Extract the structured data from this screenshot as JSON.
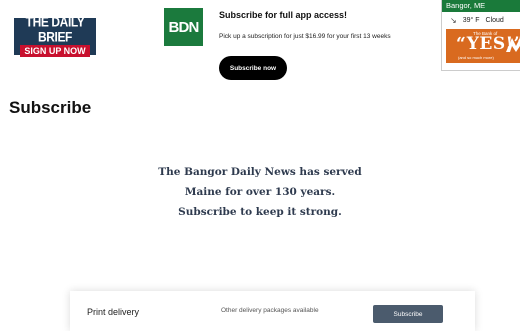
{
  "daily_brief": {
    "title": "THE DAILY BRIEF",
    "cta": "SIGN UP NOW"
  },
  "logo": {
    "text": "BDN"
  },
  "promo": {
    "title": "Subscribe for full app access!",
    "description": "Pick up a subscription for just $16.99 for your first 13 weeks",
    "button": "Subscribe now"
  },
  "weather": {
    "location": "Bangor, ME",
    "icon": "wind-icon",
    "temperature": "39° F",
    "condition": "Cloud",
    "ad": {
      "small": "The Bank of",
      "big": "“YES!”",
      "foot": "(and so much more)"
    }
  },
  "page_title": "Subscribe",
  "tagline": [
    "The Bangor Daily News has served",
    "Maine for over 130 years.",
    "Subscribe to keep it strong."
  ],
  "plan_card": {
    "title": "Print delivery",
    "subtitle": "",
    "other": "Other delivery packages available",
    "other_sub": "",
    "button": "Subscribe"
  },
  "colors": {
    "brand_green": "#1b7a3d",
    "brief_navy": "#1f3a56",
    "brief_red": "#c8102e",
    "ad_orange": "#d96a1f",
    "tagline_navy": "#2e3a4e",
    "card_button": "#4b5b6d"
  }
}
